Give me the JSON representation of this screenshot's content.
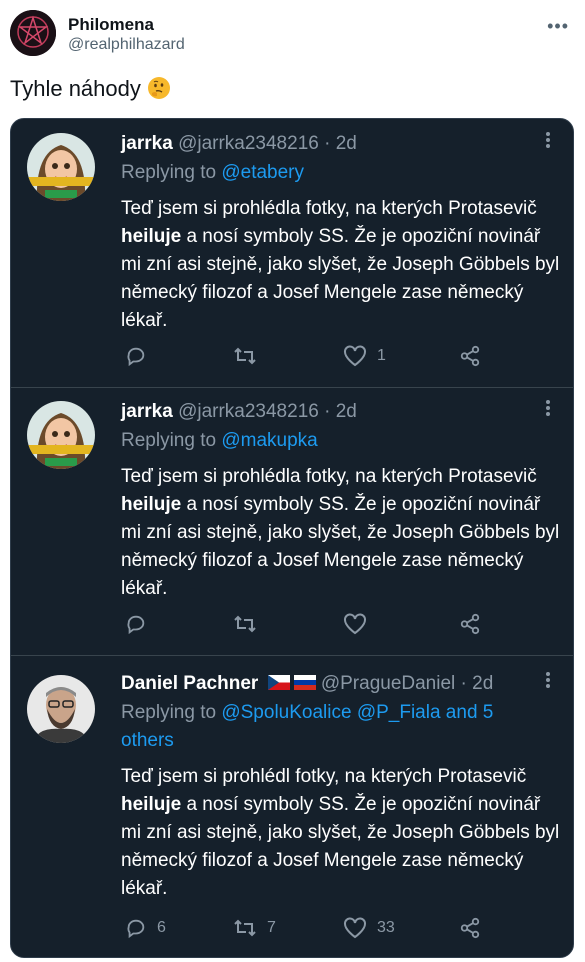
{
  "outer_post": {
    "name": "Philomena",
    "handle": "@realphilhazard",
    "text": "Tyhle náhody",
    "more_icon": "ellipsis-horizontal-icon"
  },
  "tweets": [
    {
      "name": "jarrka",
      "handle_time": "@jarrka2348216 · 2d",
      "replying_prefix": "Replying to ",
      "replying_to": "@etabery",
      "body_before": "Teď jsem si prohlédla fotky, na kterých Protasevič ",
      "body_bold": "heiluje",
      "body_after": " a nosí symboly SS. Že je opoziční novinář mi zní asi stejně, jako slyšet, že Joseph Göbbels byl německý filozof a Josef Mengele zase německý lékař.",
      "replies": "",
      "retweets": "",
      "likes": "1"
    },
    {
      "name": "jarrka",
      "handle_time": "@jarrka2348216 · 2d",
      "replying_prefix": "Replying to ",
      "replying_to": "@makupka",
      "body_before": "Teď jsem si prohlédla fotky, na kterých Protasevič ",
      "body_bold": "heiluje",
      "body_after": " a nosí symboly SS. Že je opoziční novinář mi zní asi stejně, jako slyšet, že Joseph Göbbels byl německý filozof a Josef Mengele zase německý lékař.",
      "replies": "",
      "retweets": "",
      "likes": ""
    },
    {
      "name": "Daniel Pachner",
      "handle_time": "@PragueDaniel · 2d",
      "replying_prefix": "Replying to ",
      "replying_to": "@SpoluKoalice @P_Fiala and 5 others",
      "body_before": "Teď jsem si prohlédl fotky, na kterých Protasevič ",
      "body_bold": "heiluje",
      "body_after": " a nosí symboly SS. Že je opoziční novinář mi zní asi stejně, jako slyšet, že Joseph Göbbels byl německý filozof a Josef Mengele zase německý lékař.",
      "replies": "6",
      "retweets": "7",
      "likes": "33"
    }
  ],
  "colors": {
    "dark_bg": "#15202b",
    "link": "#1d9bf0",
    "muted": "#8b98a5"
  }
}
